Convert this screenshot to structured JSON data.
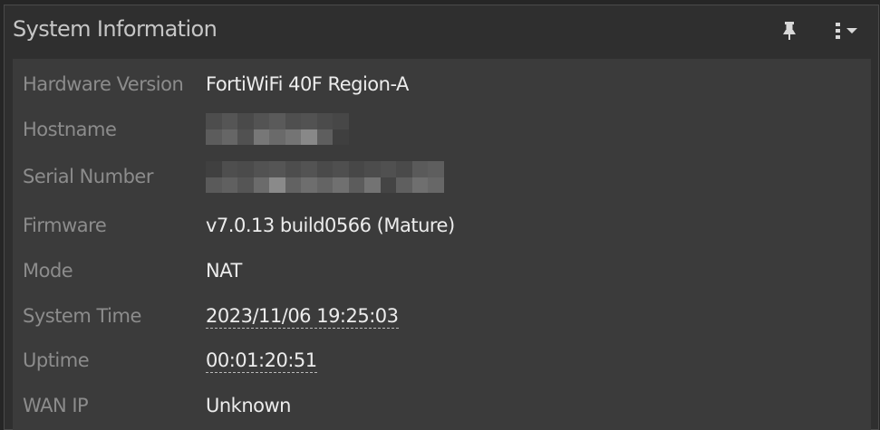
{
  "widget": {
    "title": "System Information",
    "pin_icon": "pin-icon",
    "menu_icon": "kebab-menu-icon",
    "caret_icon": "caret-down-icon"
  },
  "rows": [
    {
      "label": "Hardware Version",
      "value": "FortiWiFi 40F Region-A"
    },
    {
      "label": "Hostname",
      "value": ""
    },
    {
      "label": "Serial Number",
      "value": ""
    },
    {
      "label": "Firmware",
      "value": "v7.0.13 build0566 (Mature)"
    },
    {
      "label": "Mode",
      "value": "NAT"
    },
    {
      "label": "System Time",
      "value": "2023/11/06 19:25:03"
    },
    {
      "label": "Uptime",
      "value": "00:01:20:51"
    },
    {
      "label": "WAN IP",
      "value": "Unknown"
    }
  ],
  "colors": {
    "page_bg": "#262626",
    "panel_bg": "#2f2f2f",
    "body_bg": "#3b3b3b",
    "label": "#8c8c8c",
    "value": "#ececec"
  }
}
